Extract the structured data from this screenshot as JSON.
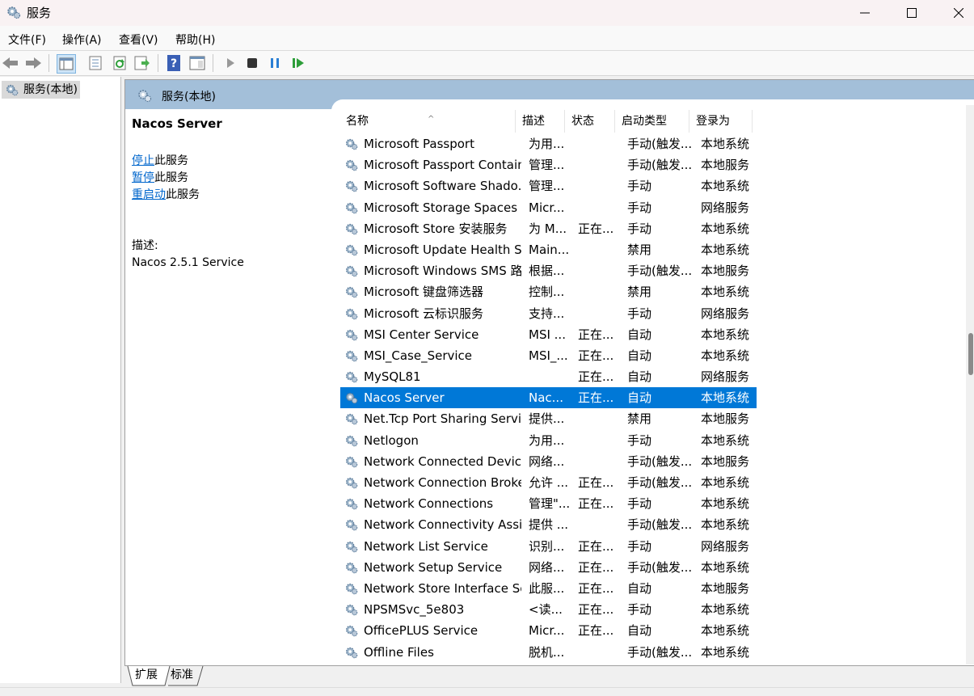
{
  "window": {
    "title": "服务",
    "minimize_icon": "minimize-icon",
    "maximize_icon": "maximize-icon",
    "close_icon": "close-icon"
  },
  "menu": {
    "items": [
      "文件(F)",
      "操作(A)",
      "查看(V)",
      "帮助(H)"
    ]
  },
  "toolbar": {
    "icons": [
      "back-arrow-icon",
      "forward-arrow-icon",
      "show-hide-tree-icon",
      "properties-icon",
      "refresh-icon",
      "export-list-icon",
      "help-icon",
      "view-pane-icon",
      "start-service-icon",
      "stop-service-icon",
      "pause-service-icon",
      "resume-service-icon"
    ]
  },
  "tree": {
    "node_label": "服务(本地)"
  },
  "content": {
    "header_title": "服务(本地)",
    "selected_service": "Nacos Server",
    "actions": [
      {
        "link": "停止",
        "suffix": "此服务"
      },
      {
        "link": "暂停",
        "suffix": "此服务"
      },
      {
        "link": "重启动",
        "suffix": "此服务"
      }
    ],
    "desc_label": "描述:",
    "desc_text": "Nacos 2.5.1 Service"
  },
  "list": {
    "columns": [
      "名称",
      "描述",
      "状态",
      "启动类型",
      "登录为"
    ],
    "sort_indicator": "^",
    "selected_index": 12,
    "rows": [
      [
        "Microsoft Passport",
        "为用...",
        "",
        "手动(触发...",
        "本地系统"
      ],
      [
        "Microsoft Passport Container",
        "管理...",
        "",
        "手动(触发...",
        "本地服务"
      ],
      [
        "Microsoft Software Shado...",
        "管理...",
        "",
        "手动",
        "本地系统"
      ],
      [
        "Microsoft Storage Spaces S...",
        "Micr...",
        "",
        "手动",
        "网络服务"
      ],
      [
        "Microsoft Store 安装服务",
        "为 M...",
        "正在...",
        "手动",
        "本地系统"
      ],
      [
        "Microsoft Update Health S...",
        "Main...",
        "",
        "禁用",
        "本地系统"
      ],
      [
        "Microsoft Windows SMS 路...",
        "根据...",
        "",
        "手动(触发...",
        "本地服务"
      ],
      [
        "Microsoft 键盘筛选器",
        "控制...",
        "",
        "禁用",
        "本地系统"
      ],
      [
        "Microsoft 云标识服务",
        "支持...",
        "",
        "手动",
        "网络服务"
      ],
      [
        "MSI Center Service",
        "MSI ...",
        "正在...",
        "自动",
        "本地系统"
      ],
      [
        "MSI_Case_Service",
        "MSI_...",
        "正在...",
        "自动",
        "本地系统"
      ],
      [
        "MySQL81",
        "",
        "正在...",
        "自动",
        "网络服务"
      ],
      [
        "Nacos Server",
        "Nac...",
        "正在...",
        "自动",
        "本地系统"
      ],
      [
        "Net.Tcp Port Sharing Service",
        "提供...",
        "",
        "禁用",
        "本地服务"
      ],
      [
        "Netlogon",
        "为用...",
        "",
        "手动",
        "本地系统"
      ],
      [
        "Network Connected Devic...",
        "网络...",
        "",
        "手动(触发...",
        "本地服务"
      ],
      [
        "Network Connection Broker",
        "允许 ...",
        "正在...",
        "手动(触发...",
        "本地系统"
      ],
      [
        "Network Connections",
        "管理\"...",
        "正在...",
        "手动",
        "本地系统"
      ],
      [
        "Network Connectivity Assis...",
        "提供 ...",
        "",
        "手动(触发...",
        "本地系统"
      ],
      [
        "Network List Service",
        "识别...",
        "正在...",
        "手动",
        "网络服务"
      ],
      [
        "Network Setup Service",
        "网络...",
        "正在...",
        "手动(触发...",
        "本地系统"
      ],
      [
        "Network Store Interface Se...",
        "此服...",
        "正在...",
        "自动",
        "本地服务"
      ],
      [
        "NPSMSvc_5e803",
        "<读...",
        "正在...",
        "手动",
        "本地系统"
      ],
      [
        "OfficePLUS Service",
        "Micr...",
        "正在...",
        "自动",
        "本地系统"
      ],
      [
        "Offline Files",
        "脱机...",
        "",
        "手动(触发...",
        "本地系统"
      ]
    ]
  },
  "bottom_tabs": [
    "扩展",
    "标准"
  ],
  "colors": {
    "selection": "#0078d7",
    "header_band": "#a3bfd9",
    "link": "#0066cc",
    "titlebar": "#f9f2f3"
  }
}
